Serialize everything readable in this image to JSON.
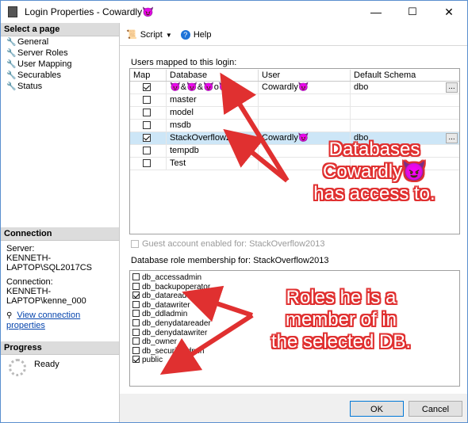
{
  "window": {
    "title": "Login Properties - Cowardly😈",
    "min": "—",
    "max": "☐",
    "close": "✕"
  },
  "left": {
    "select_page": "Select a page",
    "pages": [
      "General",
      "Server Roles",
      "User Mapping",
      "Securables",
      "Status"
    ],
    "connection_header": "Connection",
    "server_label": "Server:",
    "server_value": "KENNETH-LAPTOP\\SQL2017CS",
    "connection_label": "Connection:",
    "connection_value": "KENNETH-LAPTOP\\kenne_000",
    "view_link": "View connection properties",
    "progress_header": "Progress",
    "progress_status": "Ready"
  },
  "toolbar": {
    "script": "Script",
    "help": "Help"
  },
  "mapping": {
    "label": "Users mapped to this login:",
    "columns": [
      "Map",
      "Database",
      "User",
      "Default Schema"
    ],
    "rows": [
      {
        "map": true,
        "database": "😈&😈&😈o😈",
        "user": "Cowardly😈",
        "schema": "dbo",
        "selected": false
      },
      {
        "map": false,
        "database": "master",
        "user": "",
        "schema": "",
        "selected": false
      },
      {
        "map": false,
        "database": "model",
        "user": "",
        "schema": "",
        "selected": false
      },
      {
        "map": false,
        "database": "msdb",
        "user": "",
        "schema": "",
        "selected": false
      },
      {
        "map": true,
        "database": "StackOverflow2013",
        "user": "Cowardly😈",
        "schema": "dbo",
        "selected": true
      },
      {
        "map": false,
        "database": "tempdb",
        "user": "",
        "schema": "",
        "selected": false
      },
      {
        "map": false,
        "database": "Test",
        "user": "",
        "schema": "",
        "selected": false
      }
    ]
  },
  "guest": "Guest account enabled for: StackOverflow2013",
  "roles": {
    "label": "Database role membership for: StackOverflow2013",
    "items": [
      {
        "name": "db_accessadmin",
        "checked": false
      },
      {
        "name": "db_backupoperator",
        "checked": false
      },
      {
        "name": "db_datareader",
        "checked": true
      },
      {
        "name": "db_datawriter",
        "checked": false
      },
      {
        "name": "db_ddladmin",
        "checked": false
      },
      {
        "name": "db_denydatareader",
        "checked": false
      },
      {
        "name": "db_denydatawriter",
        "checked": false
      },
      {
        "name": "db_owner",
        "checked": false
      },
      {
        "name": "db_securityadmin",
        "checked": false
      },
      {
        "name": "public",
        "checked": true
      }
    ]
  },
  "buttons": {
    "ok": "OK",
    "cancel": "Cancel"
  },
  "annotations": {
    "a1_line1": "Databases",
    "a1_line2": "Cowardly😈",
    "a1_line3": "has access to.",
    "a2_line1": "Roles he is a",
    "a2_line2": "member of in",
    "a2_line3": "the selected DB."
  },
  "colors": {
    "annotation": "#e03030",
    "selection": "#cde6f7",
    "link": "#0645ad"
  }
}
